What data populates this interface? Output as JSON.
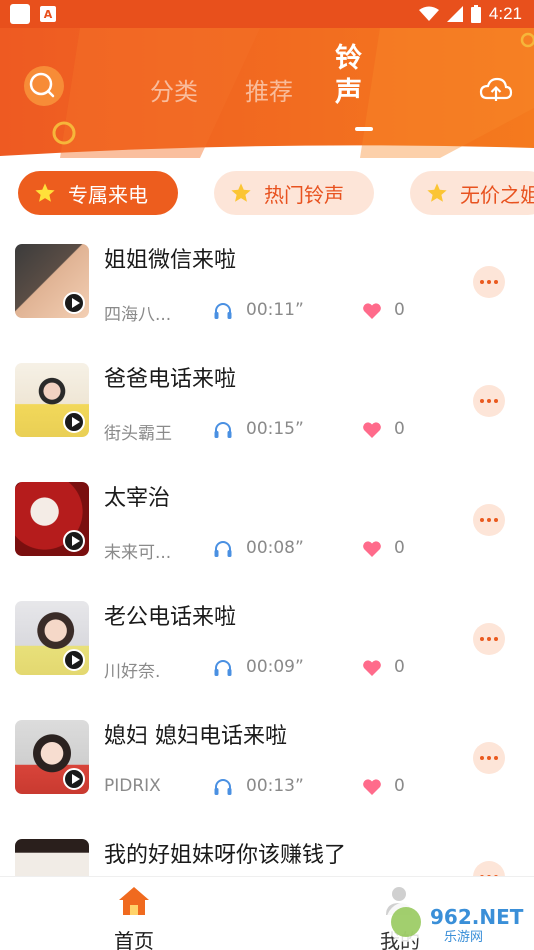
{
  "status_bar": {
    "time": "4:21",
    "notification_icon": "A"
  },
  "header": {
    "tabs": [
      {
        "label": "分类",
        "active": false
      },
      {
        "label": "推荐",
        "active": false
      },
      {
        "label": "铃声",
        "active": true
      }
    ],
    "search_icon": "search-icon",
    "upload_icon": "cloud-upload-icon"
  },
  "chips": [
    {
      "label": "专属来电",
      "active": true,
      "icon": "star-icon"
    },
    {
      "label": "热门铃声",
      "active": false,
      "icon": "star-icon"
    },
    {
      "label": "无价之姐",
      "active": false,
      "icon": "star-icon"
    }
  ],
  "ringtones": [
    {
      "title": "姐姐微信来啦",
      "author": "四海八...",
      "duration": "00:11”",
      "likes": "0"
    },
    {
      "title": "爸爸电话来啦",
      "author": "街头霸王",
      "duration": "00:15”",
      "likes": "0"
    },
    {
      "title": "太宰治",
      "author": "末来可...",
      "duration": "00:08”",
      "likes": "0"
    },
    {
      "title": "老公电话来啦",
      "author": "川好奈.",
      "duration": "00:09”",
      "likes": "0"
    },
    {
      "title": "媳妇 媳妇电话来啦",
      "author": "PIDRIX",
      "duration": "00:13”",
      "likes": "0"
    },
    {
      "title": "我的好姐妹呀你该赚钱了",
      "author": "",
      "duration": "",
      "likes": ""
    }
  ],
  "bottom_nav": [
    {
      "label": "首页",
      "active": true
    },
    {
      "label": "我的",
      "active": false
    }
  ],
  "watermark": "962.NET 乐游网",
  "colors": {
    "accent": "#ed5d1e",
    "chip_bg": "#fde5d8",
    "heart": "#ff6b8b",
    "headphone": "#4a90e2"
  }
}
